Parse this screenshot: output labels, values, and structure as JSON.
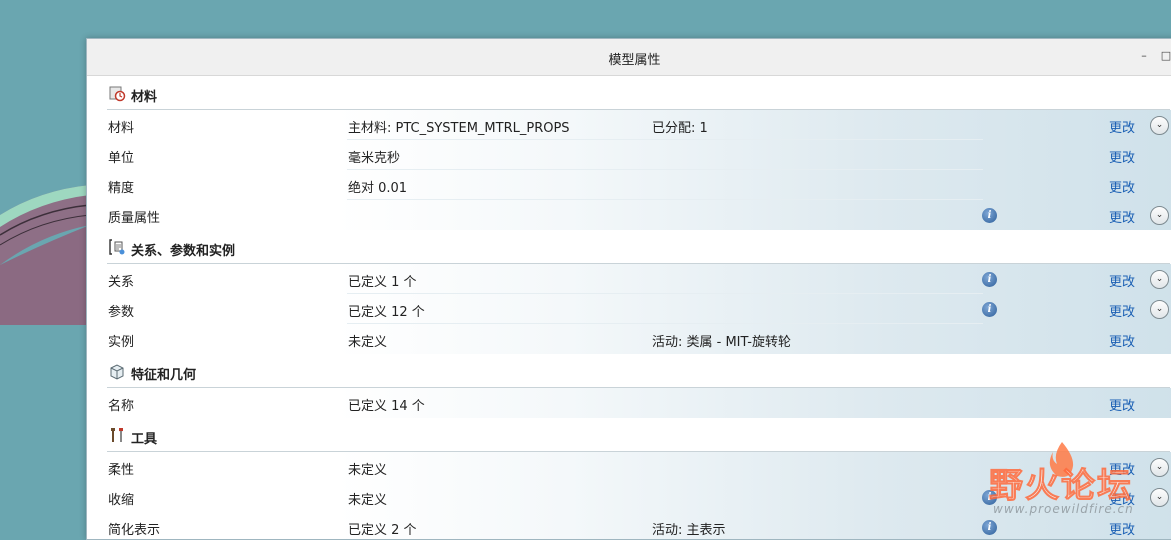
{
  "dialog": {
    "title": "模型属性",
    "minimize_glyph": "–",
    "maximize_glyph": "□"
  },
  "icons": {
    "materials": "materials-icon",
    "relations": "relations-icon",
    "features": "features-icon",
    "tools": "tools-icon",
    "info": "info-icon",
    "expand": "chevron-down-icon"
  },
  "colors": {
    "link": "#1a5fb4",
    "background": "#6aa6b0",
    "row_gradient_end": "#cfe1ea",
    "watermark_red": "#ff6a3c"
  },
  "info_glyph": "i",
  "expand_glyph": "⌄",
  "sections": [
    {
      "title": "材料",
      "rows": [
        {
          "label": "材料",
          "value": "主材料: PTC_SYSTEM_MTRL_PROPS",
          "extra": "已分配: 1",
          "change": "更改"
        },
        {
          "label": "单位",
          "value": "毫米克秒",
          "extra": "",
          "change": "更改"
        },
        {
          "label": "精度",
          "value": "绝对 0.01",
          "extra": "",
          "change": "更改"
        },
        {
          "label": "质量属性",
          "value": "",
          "extra": "",
          "change": "更改"
        }
      ]
    },
    {
      "title": "关系、参数和实例",
      "rows": [
        {
          "label": "关系",
          "value": "已定义 1 个",
          "extra": "",
          "change": "更改"
        },
        {
          "label": "参数",
          "value": "已定义 12 个",
          "extra": "",
          "change": "更改"
        },
        {
          "label": "实例",
          "value": "未定义",
          "extra": "活动: 类属 - MIT-旋转轮",
          "change": "更改"
        }
      ]
    },
    {
      "title": "特征和几何",
      "rows": [
        {
          "label": "名称",
          "value": "已定义 14 个",
          "extra": "",
          "change": "更改"
        }
      ]
    },
    {
      "title": "工具",
      "rows": [
        {
          "label": "柔性",
          "value": "未定义",
          "extra": "",
          "change": "更改"
        },
        {
          "label": "收缩",
          "value": "未定义",
          "extra": "",
          "change": "更改"
        },
        {
          "label": "简化表示",
          "value": "已定义 2 个",
          "extra": "活动: 主表示",
          "change": "更改"
        }
      ]
    }
  ],
  "watermark": {
    "brand": "野火论坛",
    "url": "www.proewildfire.cn"
  }
}
